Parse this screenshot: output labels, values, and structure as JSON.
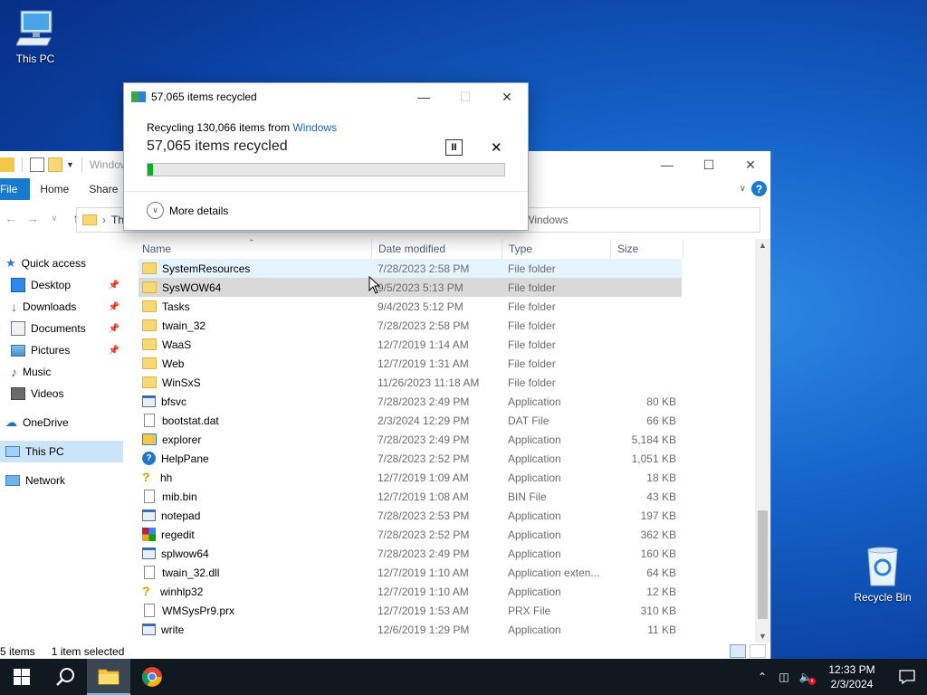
{
  "desktop": {
    "icons": [
      {
        "label": "This PC",
        "icon": "this-pc-icon"
      },
      {
        "label": "Recycle Bin",
        "icon": "recycle-bin-icon"
      }
    ]
  },
  "explorer": {
    "title": "Windows",
    "ribbon_tabs": [
      "File",
      "Home",
      "Share"
    ],
    "address_left": "Th",
    "address_right": "Windows",
    "nav": [
      {
        "label": "Quick access",
        "icon": "star-icon",
        "pinned": false
      },
      {
        "label": "Desktop",
        "icon": "desktop-icon",
        "pinned": true
      },
      {
        "label": "Downloads",
        "icon": "download-icon",
        "pinned": true
      },
      {
        "label": "Documents",
        "icon": "documents-icon",
        "pinned": true
      },
      {
        "label": "Pictures",
        "icon": "pictures-icon",
        "pinned": true
      },
      {
        "label": "Music",
        "icon": "music-icon",
        "pinned": false
      },
      {
        "label": "Videos",
        "icon": "videos-icon",
        "pinned": false
      },
      {
        "label": "OneDrive",
        "icon": "cloud-icon",
        "pinned": false
      },
      {
        "label": "This PC",
        "icon": "this-pc-icon",
        "pinned": false
      },
      {
        "label": "Network",
        "icon": "network-icon",
        "pinned": false
      }
    ],
    "columns": [
      "Name",
      "Date modified",
      "Type",
      "Size"
    ],
    "files": [
      {
        "name": "SystemResources",
        "date": "7/28/2023 2:58 PM",
        "type": "File folder",
        "size": "",
        "icon": "folder"
      },
      {
        "name": "SysWOW64",
        "date": "9/5/2023 5:13 PM",
        "type": "File folder",
        "size": "",
        "icon": "folder"
      },
      {
        "name": "Tasks",
        "date": "9/4/2023 5:12 PM",
        "type": "File folder",
        "size": "",
        "icon": "folder"
      },
      {
        "name": "twain_32",
        "date": "7/28/2023 2:58 PM",
        "type": "File folder",
        "size": "",
        "icon": "folder"
      },
      {
        "name": "WaaS",
        "date": "12/7/2019 1:14 AM",
        "type": "File folder",
        "size": "",
        "icon": "folder"
      },
      {
        "name": "Web",
        "date": "12/7/2019 1:31 AM",
        "type": "File folder",
        "size": "",
        "icon": "folder"
      },
      {
        "name": "WinSxS",
        "date": "11/26/2023 11:18 AM",
        "type": "File folder",
        "size": "",
        "icon": "folder"
      },
      {
        "name": "bfsvc",
        "date": "7/28/2023 2:49 PM",
        "type": "Application",
        "size": "80 KB",
        "icon": "app"
      },
      {
        "name": "bootstat.dat",
        "date": "2/3/2024 12:29 PM",
        "type": "DAT File",
        "size": "66 KB",
        "icon": "file"
      },
      {
        "name": "explorer",
        "date": "7/28/2023 2:49 PM",
        "type": "Application",
        "size": "5,184 KB",
        "icon": "explorer"
      },
      {
        "name": "HelpPane",
        "date": "7/28/2023 2:52 PM",
        "type": "Application",
        "size": "1,051 KB",
        "icon": "help"
      },
      {
        "name": "hh",
        "date": "12/7/2019 1:09 AM",
        "type": "Application",
        "size": "18 KB",
        "icon": "question"
      },
      {
        "name": "mib.bin",
        "date": "12/7/2019 1:08 AM",
        "type": "BIN File",
        "size": "43 KB",
        "icon": "file"
      },
      {
        "name": "notepad",
        "date": "7/28/2023 2:53 PM",
        "type": "Application",
        "size": "197 KB",
        "icon": "app"
      },
      {
        "name": "regedit",
        "date": "7/28/2023 2:52 PM",
        "type": "Application",
        "size": "362 KB",
        "icon": "regedit"
      },
      {
        "name": "splwow64",
        "date": "7/28/2023 2:49 PM",
        "type": "Application",
        "size": "160 KB",
        "icon": "app"
      },
      {
        "name": "twain_32.dll",
        "date": "12/7/2019 1:10 AM",
        "type": "Application exten...",
        "size": "64 KB",
        "icon": "file"
      },
      {
        "name": "winhlp32",
        "date": "12/7/2019 1:10 AM",
        "type": "Application",
        "size": "12 KB",
        "icon": "question"
      },
      {
        "name": "WMSysPr9.prx",
        "date": "12/7/2019 1:53 AM",
        "type": "PRX File",
        "size": "310 KB",
        "icon": "file"
      },
      {
        "name": "write",
        "date": "12/6/2019 1:29 PM",
        "type": "Application",
        "size": "11 KB",
        "icon": "app"
      }
    ],
    "status_items": "5 items",
    "status_selected": "1 item selected"
  },
  "dialog": {
    "title": "57,065 items recycled",
    "subtitle_prefix": "Recycling 130,066 items from ",
    "subtitle_link": "Windows",
    "headline": "57,065 items recycled",
    "progress": 0.015,
    "pause_label": "II",
    "cancel_label": "✕",
    "more_details": "More details"
  },
  "taskbar": {
    "time": "12:33 PM",
    "date": "2/3/2024",
    "apps": [
      "start-icon",
      "search-icon",
      "file-explorer-icon",
      "chrome-icon"
    ]
  },
  "colors": {
    "accent": "#1979ca",
    "progress": "#06b025",
    "link": "#1a65b8"
  }
}
